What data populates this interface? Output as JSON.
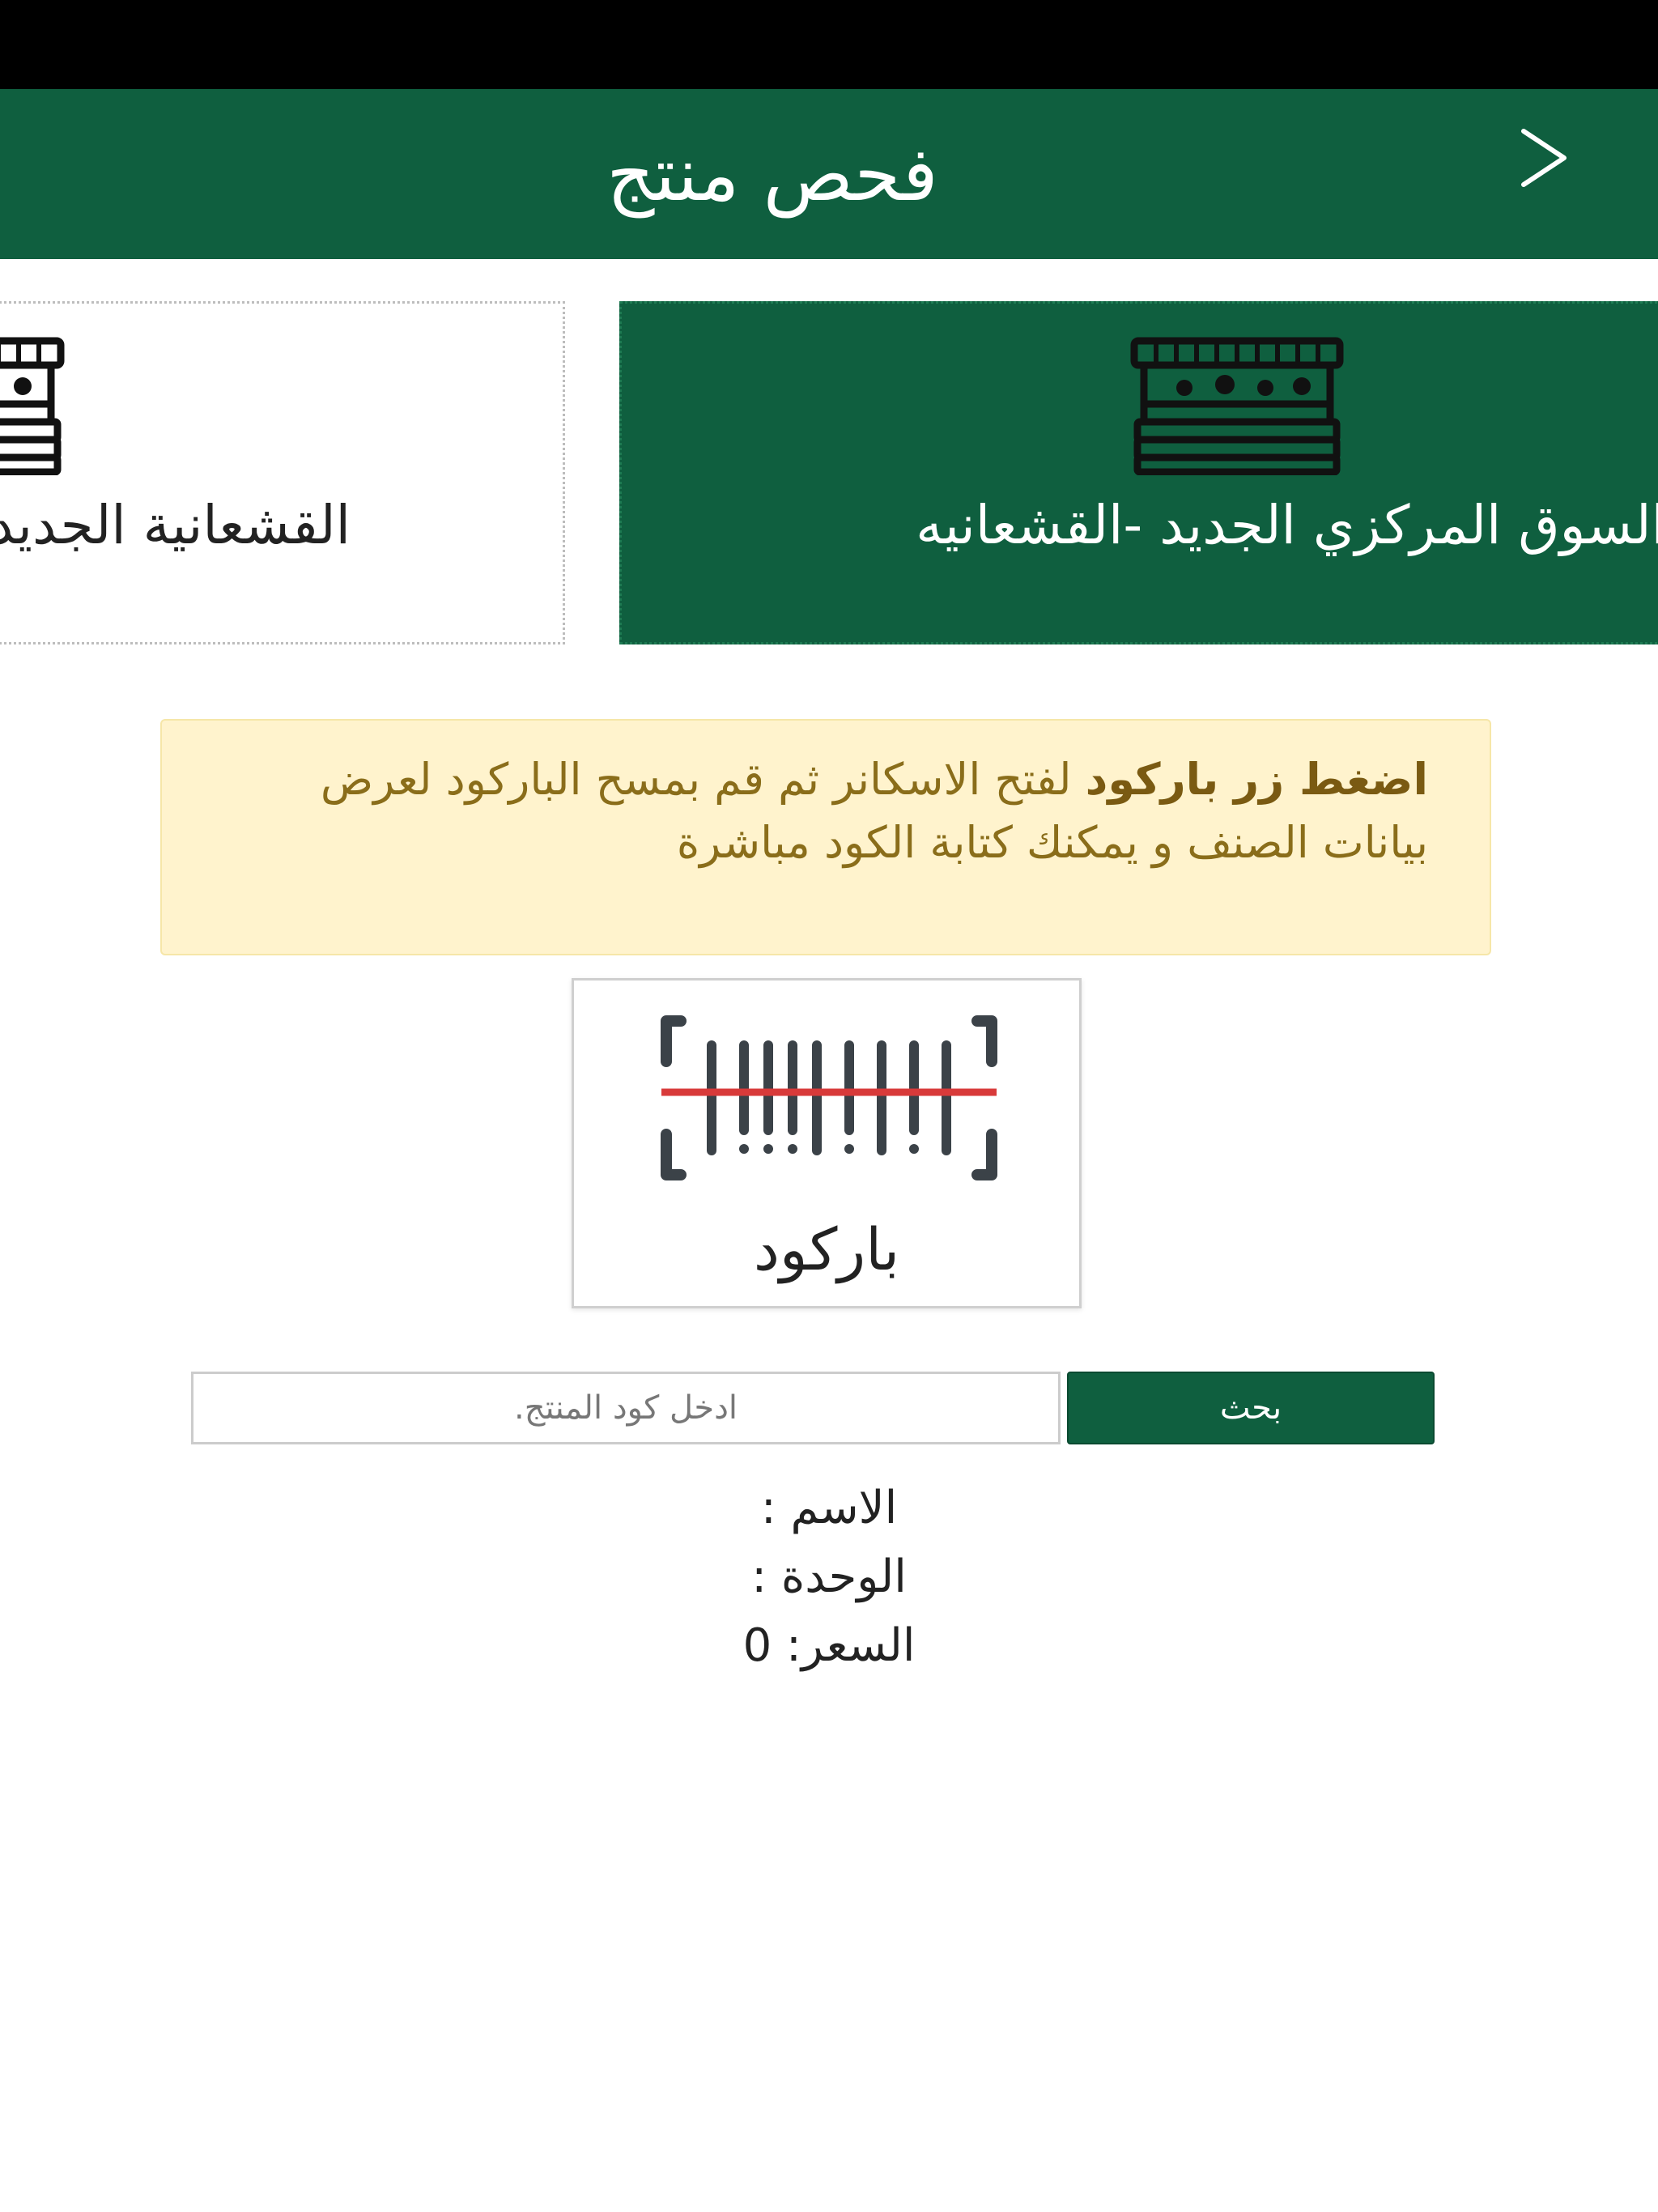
{
  "header": {
    "title": "فحص منتج",
    "back_glyph": ">"
  },
  "markets": [
    {
      "name": "السوق المركزي الجديد -القشعانيه",
      "selected": true,
      "icon": "market-stall-icon"
    },
    {
      "name": "القشعانية الجديد",
      "selected": false,
      "icon": "market-stall-icon"
    }
  ],
  "notice": {
    "bold": "اضغط زر باركود",
    "text": " لفتح الاسكانر ثم قم بمسح الباركود لعرض بيانات الصنف و يمكنك كتابة الكود مباشرة"
  },
  "barcode_button": {
    "label": "باركود",
    "icon": "barcode-scan-icon"
  },
  "search": {
    "placeholder": "ادخل كود المنتج.",
    "value": "",
    "button_label": "بحث"
  },
  "result": {
    "name": "الاسم :",
    "unit": "الوحدة :",
    "price": "السعر: 0"
  },
  "colors": {
    "primary": "#0f5f3f",
    "notice_bg": "#fff3cd",
    "notice_text": "#8a6d1a",
    "scan_line": "#d83a3a"
  }
}
